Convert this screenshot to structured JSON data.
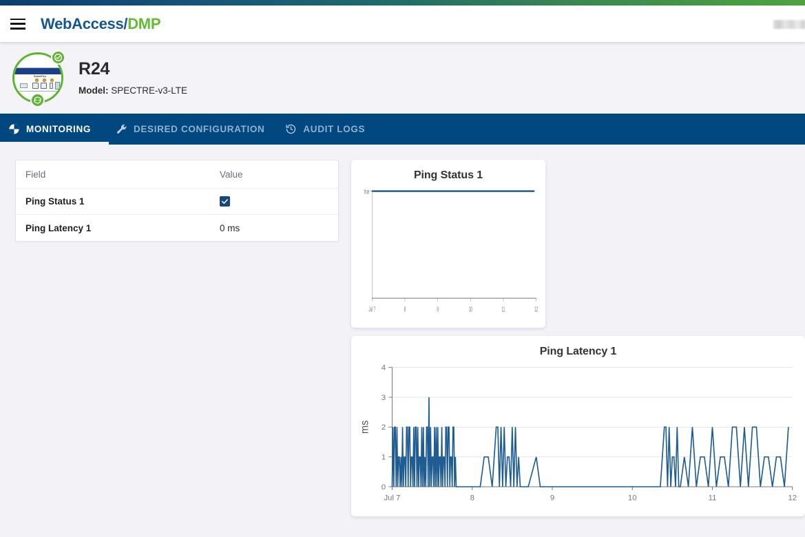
{
  "header": {
    "brand_primary": "WebAccess/",
    "brand_accent": "DMP",
    "menu_icon": "hamburger-icon",
    "user_label": ""
  },
  "device": {
    "name": "R24",
    "model_label": "Model:",
    "model_value": "SPECTRE-v3-LTE",
    "status_badge": "check-badge",
    "sync_badge": "sync-badge"
  },
  "tabs": [
    {
      "label": "MONITORING",
      "icon": "pie-chart-icon",
      "active": true
    },
    {
      "label": "DESIRED CONFIGURATION",
      "icon": "wrench-icon",
      "active": false
    },
    {
      "label": "AUDIT LOGS",
      "icon": "history-clock-icon",
      "active": false
    }
  ],
  "table": {
    "headers": {
      "field": "Field",
      "value": "Value"
    },
    "rows": [
      {
        "field": "Ping Status 1",
        "value": "",
        "type": "checkbox",
        "checked": true
      },
      {
        "field": "Ping Latency 1",
        "value": "0 ms",
        "type": "text",
        "checked": false
      }
    ]
  },
  "colors": {
    "brand_blue": "#14578f",
    "brand_green": "#63bb33",
    "tabbar_blue": "#014881",
    "series_blue": "#1f5c92",
    "checkbox_blue": "#16477d",
    "page_bg": "#f2f2f7"
  },
  "chart_data": [
    {
      "type": "line",
      "title": "Ping Status 1",
      "xlabel": "",
      "ylabel": "",
      "ytick_labels": [
        "true"
      ],
      "ytick_values": [
        1
      ],
      "ylim": [
        0,
        1
      ],
      "xtick_labels": [
        "Jul 7",
        "8",
        "9",
        "10",
        "11",
        "12"
      ],
      "xtick_values": [
        7,
        8,
        9,
        10,
        11,
        12
      ],
      "xlim": [
        7,
        12
      ],
      "grid": false,
      "legend": "none",
      "series": [
        {
          "name": "Ping Status 1",
          "x": [
            7,
            7.5,
            8,
            8.5,
            9,
            9.5,
            10,
            10.5,
            11,
            11.5,
            11.95
          ],
          "values": [
            1,
            1,
            1,
            1,
            1,
            1,
            1,
            1,
            1,
            1,
            1
          ]
        }
      ]
    },
    {
      "type": "line",
      "title": "Ping Latency 1",
      "xlabel": "",
      "ylabel": "ms",
      "ytick_labels": [
        "0",
        "1",
        "2",
        "3",
        "4"
      ],
      "ytick_values": [
        0,
        1,
        2,
        3,
        4
      ],
      "ylim": [
        0,
        4
      ],
      "xtick_labels": [
        "Jul 7",
        "8",
        "9",
        "10",
        "11",
        "12"
      ],
      "xtick_values": [
        7,
        8,
        9,
        10,
        11,
        12
      ],
      "xlim": [
        7,
        12
      ],
      "grid": true,
      "legend": "none",
      "series": [
        {
          "name": "Ping Latency 1",
          "x": [
            7.0,
            7.01,
            7.02,
            7.03,
            7.04,
            7.05,
            7.06,
            7.07,
            7.08,
            7.09,
            7.1,
            7.11,
            7.12,
            7.13,
            7.14,
            7.15,
            7.16,
            7.17,
            7.18,
            7.19,
            7.2,
            7.21,
            7.22,
            7.23,
            7.24,
            7.25,
            7.26,
            7.27,
            7.28,
            7.29,
            7.3,
            7.31,
            7.32,
            7.33,
            7.34,
            7.35,
            7.36,
            7.37,
            7.38,
            7.39,
            7.4,
            7.41,
            7.42,
            7.43,
            7.44,
            7.45,
            7.46,
            7.47,
            7.48,
            7.49,
            7.5,
            7.51,
            7.52,
            7.53,
            7.54,
            7.55,
            7.56,
            7.57,
            7.58,
            7.59,
            7.6,
            7.61,
            7.62,
            7.63,
            7.64,
            7.65,
            7.66,
            7.67,
            7.68,
            7.69,
            7.7,
            7.71,
            7.72,
            7.73,
            7.74,
            7.75,
            7.76,
            7.77,
            7.78,
            7.79,
            7.8,
            7.85,
            7.9,
            7.95,
            8.0,
            8.05,
            8.1,
            8.15,
            8.2,
            8.25,
            8.3,
            8.32,
            8.34,
            8.36,
            8.38,
            8.4,
            8.42,
            8.44,
            8.46,
            8.48,
            8.5,
            8.52,
            8.54,
            8.56,
            8.58,
            8.6,
            8.7,
            8.8,
            8.85,
            8.9,
            9.0,
            9.2,
            9.4,
            9.6,
            9.8,
            10.0,
            10.2,
            10.35,
            10.4,
            10.42,
            10.44,
            10.46,
            10.48,
            10.5,
            10.52,
            10.54,
            10.56,
            10.58,
            10.6,
            10.65,
            10.7,
            10.75,
            10.8,
            10.85,
            10.9,
            10.95,
            11.0,
            11.05,
            11.1,
            11.15,
            11.2,
            11.25,
            11.3,
            11.35,
            11.4,
            11.45,
            11.5,
            11.55,
            11.6,
            11.65,
            11.7,
            11.75,
            11.8,
            11.85,
            11.9,
            11.95
          ],
          "values": [
            0,
            2,
            0,
            2,
            2,
            0,
            2,
            0,
            1,
            1,
            0,
            1,
            0,
            2,
            0,
            1,
            1,
            0,
            2,
            2,
            0,
            2,
            2,
            0,
            1,
            1,
            0,
            2,
            0,
            2,
            2,
            0,
            2,
            0,
            1,
            1,
            0,
            2,
            0,
            2,
            0,
            1,
            0,
            2,
            2,
            0,
            3,
            0,
            2,
            0,
            1,
            1,
            0,
            2,
            0,
            2,
            0,
            2,
            0,
            1,
            1,
            0,
            2,
            0,
            1,
            1,
            0,
            2,
            2,
            0,
            2,
            2,
            0,
            1,
            1,
            0,
            2,
            2,
            0,
            1,
            0,
            0,
            0,
            0,
            0,
            0,
            0,
            1,
            1,
            0,
            2,
            2,
            0,
            2,
            0,
            2,
            0,
            1,
            1,
            0,
            2,
            0,
            2,
            0,
            1,
            0,
            0,
            1,
            0,
            0,
            0,
            0,
            0,
            0,
            0,
            0,
            0,
            0,
            2,
            2,
            0,
            2,
            0,
            1,
            1,
            0,
            2,
            0,
            0,
            1,
            0,
            2,
            0,
            1,
            1,
            0,
            2,
            0,
            1,
            1,
            0,
            2,
            2,
            0,
            2,
            0,
            2,
            2,
            0,
            1,
            1,
            0,
            1,
            1,
            0,
            2
          ]
        }
      ]
    }
  ]
}
